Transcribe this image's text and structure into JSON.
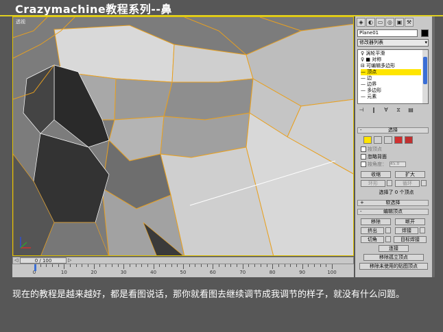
{
  "title": "Crazymachine教程系列--鼻",
  "viewport": {
    "label": "透视"
  },
  "timeline": {
    "slider": "0 / 100",
    "prev_arrow": "◁",
    "next_arrow": "▷",
    "ticks": [
      "0",
      "10",
      "20",
      "30",
      "40",
      "50",
      "60",
      "70",
      "80",
      "90",
      "100"
    ]
  },
  "panel": {
    "tabs": [
      "◈",
      "◐",
      "▭",
      "◎",
      "▣",
      "⚒"
    ],
    "object_name": "Plane01",
    "object_color": "#000000",
    "modifier_list": "修改器列表",
    "stack": [
      {
        "label": "涡轮平滑",
        "prefix": "♀"
      },
      {
        "label": "对称",
        "prefix": "♀ ■"
      },
      {
        "label": "可编辑多边形",
        "prefix": "⊟"
      },
      {
        "label": "顶点",
        "prefix": "—"
      },
      {
        "label": "边",
        "prefix": "—"
      },
      {
        "label": "边界",
        "prefix": "—"
      },
      {
        "label": "多边形",
        "prefix": "—"
      },
      {
        "label": "元素",
        "prefix": "—"
      }
    ],
    "stack_selected": 3,
    "stack_tools": [
      "⊣",
      "‖",
      "∀",
      "⧖",
      "▤"
    ],
    "selection": {
      "header": "选择",
      "sign": "-",
      "subobjects": [
        "vertex",
        "edge",
        "border",
        "polygon",
        "element"
      ],
      "active_index": 0,
      "by_vertex": "按顶点",
      "ignore_backfacing": "忽略背面",
      "by_angle": "按角度：",
      "angle_value": "45.0",
      "shrink": "收缩",
      "grow": "扩大",
      "ring": "环形",
      "loop": "循环",
      "status": "选择了 0 个顶点"
    },
    "soft_selection": {
      "header": "软选择",
      "sign": "+"
    },
    "edit_vertices": {
      "header": "编辑顶点",
      "sign": "-",
      "remove": "移除",
      "break": "断开",
      "extrude": "挤出",
      "weld": "焊接",
      "chamfer": "切角",
      "target_weld": "目标焊接",
      "connect": "连接",
      "remove_isolated": "移除孤立顶点",
      "remove_unused_map": "移除未使用的贴图顶点"
    }
  },
  "caption": "现在的教程是越来越好，都是看图说话，那你就看图去继续调节成我调节的样子，就没有什么问题。",
  "colors": {
    "background": "#575757",
    "accent_line": "#e0d020",
    "wire_selected": "#e8a020",
    "highlight": "#ffe500"
  }
}
